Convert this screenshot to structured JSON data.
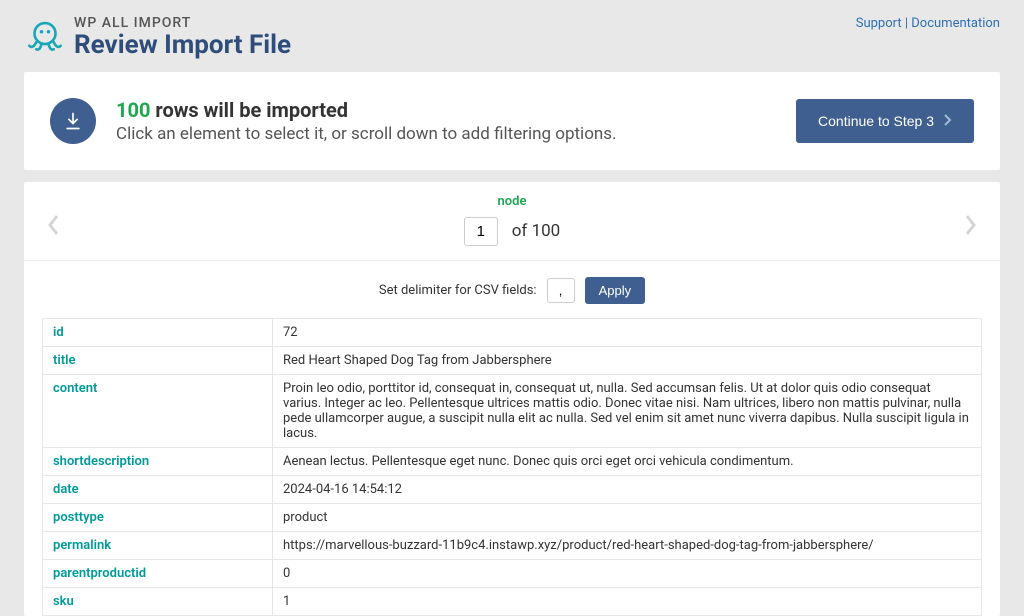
{
  "brand": {
    "name": "WP ALL IMPORT",
    "title": "Review Import File"
  },
  "header_links": {
    "support": "Support",
    "documentation": "Documentation"
  },
  "summary": {
    "count": "100",
    "title_suffix": "rows will be imported",
    "subtitle": "Click an element to select it, or scroll down to add filtering options.",
    "continue_label": "Continue to Step 3"
  },
  "pager": {
    "node_label": "node",
    "current": "1",
    "total": "100",
    "of_label": "of"
  },
  "delimiter": {
    "label": "Set delimiter for CSV fields:",
    "value": ",",
    "apply_label": "Apply"
  },
  "rows": [
    {
      "key": "id",
      "value": "72"
    },
    {
      "key": "title",
      "value": "Red Heart Shaped Dog Tag from Jabbersphere"
    },
    {
      "key": "content",
      "value": "Proin leo odio, porttitor id, consequat in, consequat ut, nulla. Sed accumsan felis. Ut at dolor quis odio consequat varius. Integer ac leo. Pellentesque ultrices mattis odio. Donec vitae nisi. Nam ultrices, libero non mattis pulvinar, nulla pede ullamcorper augue, a suscipit nulla elit ac nulla. Sed vel enim sit amet nunc viverra dapibus. Nulla suscipit ligula in lacus."
    },
    {
      "key": "shortdescription",
      "value": "Aenean lectus. Pellentesque eget nunc. Donec quis orci eget orci vehicula condimentum."
    },
    {
      "key": "date",
      "value": "2024-04-16 14:54:12"
    },
    {
      "key": "posttype",
      "value": "product"
    },
    {
      "key": "permalink",
      "value": "https://marvellous-buzzard-11b9c4.instawp.xyz/product/red-heart-shaped-dog-tag-from-jabbersphere/"
    },
    {
      "key": "parentproductid",
      "value": "0"
    },
    {
      "key": "sku",
      "value": "1"
    }
  ]
}
